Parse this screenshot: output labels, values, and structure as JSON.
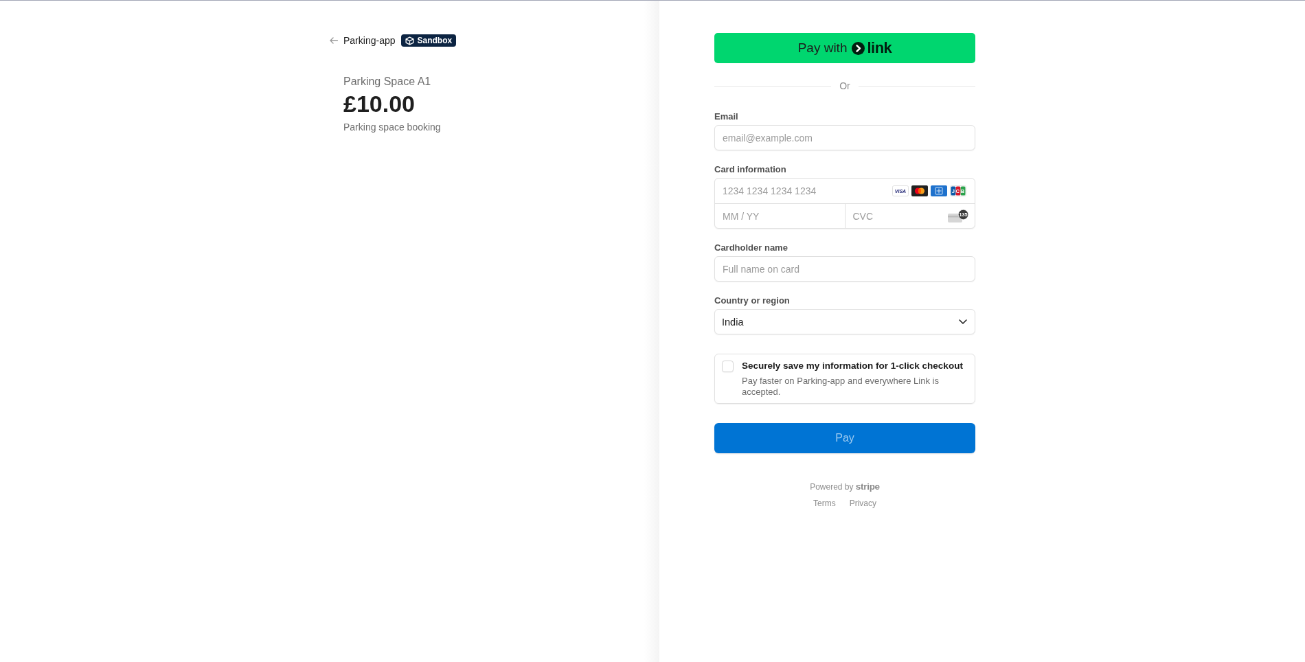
{
  "merchant": {
    "name": "Parking-app",
    "badge": "Sandbox"
  },
  "product": {
    "name": "Parking Space A1",
    "price": "£10.00",
    "description": "Parking space booking"
  },
  "link_button": {
    "label": "Pay with",
    "logo": "link"
  },
  "divider": "Or",
  "email": {
    "label": "Email",
    "placeholder": "email@example.com"
  },
  "card": {
    "label": "Card information",
    "number_placeholder": "1234 1234 1234 1234",
    "expiry_placeholder": "MM / YY",
    "cvc_placeholder": "CVC",
    "cvc_hint": "135",
    "brands": [
      {
        "kind": "visa",
        "text": "VISA"
      },
      {
        "kind": "mastercard"
      },
      {
        "kind": "amex"
      },
      {
        "kind": "jcb",
        "text": "JCB"
      }
    ]
  },
  "cardholder": {
    "label": "Cardholder name",
    "placeholder": "Full name on card"
  },
  "country": {
    "label": "Country or region",
    "value": "India"
  },
  "save_info": {
    "checked": false,
    "title": "Securely save my information for 1-click checkout",
    "description": "Pay faster on Parking-app and everywhere Link is accepted."
  },
  "pay_button": {
    "label": "Pay",
    "disabled": true
  },
  "footer": {
    "powered_by": "Powered by **stripe**",
    "links": [
      "Terms",
      "Privacy"
    ]
  }
}
